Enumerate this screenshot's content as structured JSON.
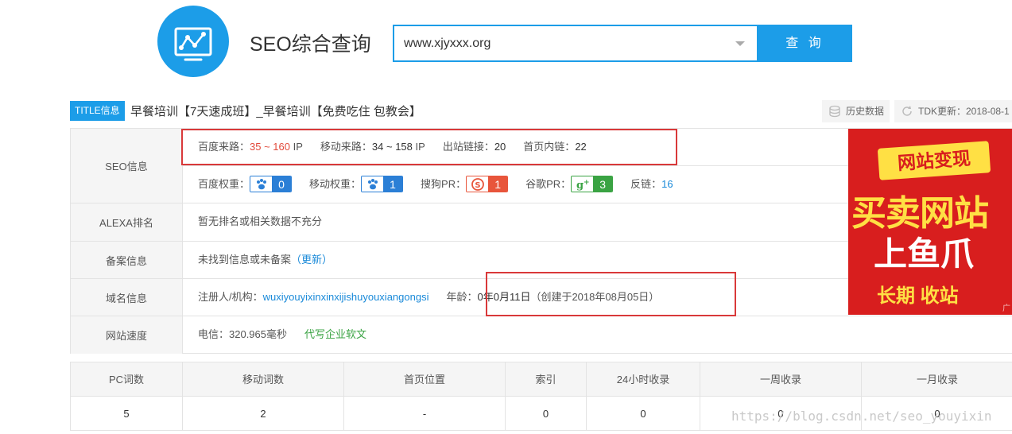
{
  "header": {
    "site_title": "SEO综合查询",
    "search_value": "www.xjyxxx.org",
    "search_button": "查 询"
  },
  "title_bar": {
    "tag": "TITLE信息",
    "title": "早餐培训【7天速成班】_早餐培训【免费吃住 包教会】",
    "history_btn": "历史数据",
    "tdk_btn": "TDK更新：2018-08-1"
  },
  "seo_info": {
    "label": "SEO信息",
    "baidu_traffic_label": "百度来路：",
    "baidu_traffic_value": "35 ~ 160",
    "baidu_traffic_unit": "IP",
    "mobile_traffic_label": "移动来路：",
    "mobile_traffic_value": "34 ~ 158",
    "mobile_traffic_unit": "IP",
    "outbound_label": "出站链接：",
    "outbound_value": "20",
    "inbound_label": "首页内链：",
    "inbound_value": "22",
    "baidu_weight_label": "百度权重：",
    "baidu_weight_value": "0",
    "mobile_weight_label": "移动权重：",
    "mobile_weight_value": "1",
    "sogou_label": "搜狗PR：",
    "sogou_value": "1",
    "google_label": "谷歌PR：",
    "google_value": "3",
    "backlink_label": "反链：",
    "backlink_value": "16"
  },
  "alexa": {
    "label": "ALEXA排名",
    "value": "暂无排名或相关数据不充分"
  },
  "icp": {
    "label": "备案信息",
    "value": "未找到信息或未备案",
    "update_link": "（更新）"
  },
  "domain": {
    "label": "域名信息",
    "registrant_label": "注册人/机构：",
    "registrant_value": "wuxiyouyixinxinxijishuyouxiangongsi",
    "age_label": "年龄：",
    "age_value": "0年0月11日",
    "created": "（创建于2018年08月05日）"
  },
  "speed": {
    "label": "网站速度",
    "value": "电信：320.965毫秒",
    "link": "代写企业软文"
  },
  "ad": {
    "top": "网站变现",
    "middle": "买卖网站",
    "band": "上鱼爪",
    "bottom": "长期 收站",
    "corner": "广"
  },
  "stats": {
    "headers": [
      "PC词数",
      "移动词数",
      "首页位置",
      "索引",
      "24小时收录",
      "一周收录",
      "一月收录"
    ],
    "values": [
      "5",
      "2",
      "-",
      "0",
      "0",
      "0",
      "0"
    ]
  },
  "watermark": "https://blog.csdn.net/seo_youyixin",
  "colors": {
    "accent": "#1c9de8",
    "highlight_red": "#d9393a",
    "link_blue": "#1a8ad9",
    "traffic_red": "#e24a3b",
    "green": "#3aa343"
  }
}
